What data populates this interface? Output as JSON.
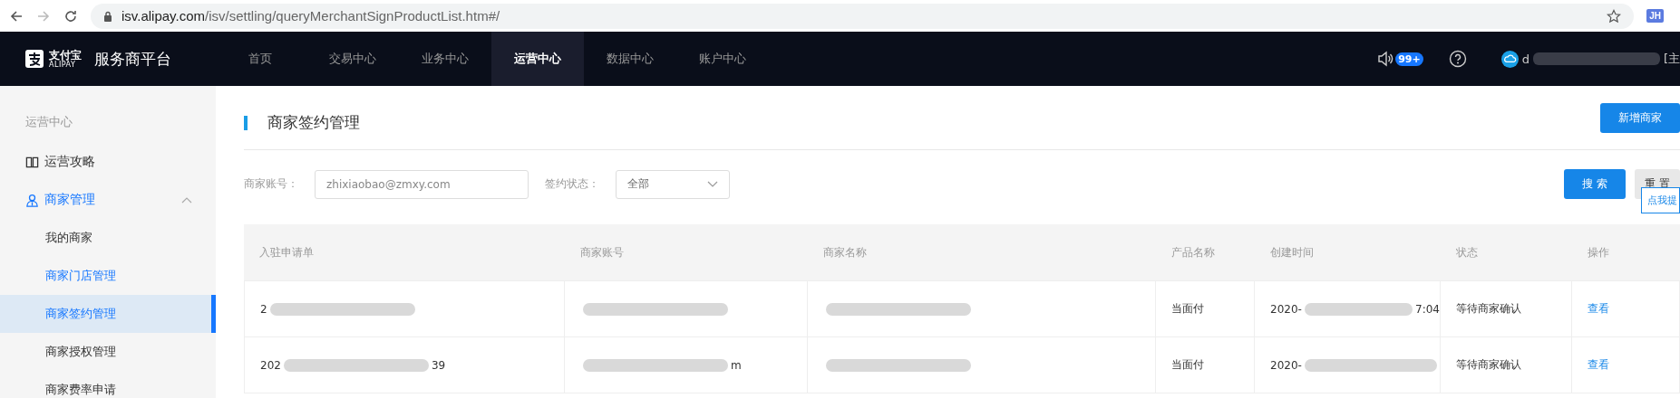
{
  "browser": {
    "url_host": "isv.alipay.com",
    "url_path": "/isv/settling/queryMerchantSignProductList.htm#/",
    "forward_disabled": true,
    "extension": "JH"
  },
  "topnav": {
    "logo_cn": "支付宝",
    "logo_en": "ALIPAY",
    "brand": "服务商平台",
    "items": [
      {
        "label": "首页",
        "selected": false
      },
      {
        "label": "交易中心",
        "selected": false
      },
      {
        "label": "业务中心",
        "selected": false
      },
      {
        "label": "运营中心",
        "selected": true
      },
      {
        "label": "数据中心",
        "selected": false
      },
      {
        "label": "账户中心",
        "selected": false
      }
    ],
    "badge": "99+",
    "user": "d",
    "user_suffix": "[主"
  },
  "sidebar": {
    "heading": "运营中心",
    "items": [
      {
        "label": "运营攻略",
        "expanded": false
      },
      {
        "label": "商家管理",
        "expanded": true,
        "children": [
          {
            "label": "我的商家",
            "selected": false,
            "highlighted": false
          },
          {
            "label": "商家门店管理",
            "selected": false,
            "highlighted": true
          },
          {
            "label": "商家签约管理",
            "selected": true,
            "highlighted": true
          },
          {
            "label": "商家授权管理",
            "selected": false,
            "highlighted": false
          },
          {
            "label": "商家费率申请",
            "selected": false,
            "highlighted": false
          }
        ]
      }
    ]
  },
  "page": {
    "title": "商家签约管理",
    "add_button": "新增商家",
    "filters": {
      "account_label": "商家账号：",
      "account_placeholder": "zhixiaobao@zmxy.com",
      "status_label": "签约状态：",
      "status_value": "全部"
    },
    "search_button": "搜 索",
    "reset_button": "重 置",
    "tooltip": "点我提"
  },
  "table": {
    "columns": [
      "入驻申请单",
      "商家账号",
      "商家名称",
      "产品名称",
      "创建时间",
      "状态",
      "操作"
    ],
    "rows": [
      {
        "cells": [
          {
            "text": "2",
            "blurred": true
          },
          {
            "blurred": true
          },
          {
            "blurred": true
          },
          {
            "text": "当面付"
          },
          {
            "text": "2020-",
            "blurred": true,
            "tail": "7:04"
          },
          {
            "text": "等待商家确认"
          },
          {
            "text": "查看",
            "kind": "link"
          }
        ]
      },
      {
        "cells": [
          {
            "text": "202",
            "blurred": true,
            "tail": "39"
          },
          {
            "blurred": true,
            "tail": "m"
          },
          {
            "blurred": true
          },
          {
            "text": "当面付"
          },
          {
            "text": "2020-",
            "blurred": true
          },
          {
            "text": "等待商家确认"
          },
          {
            "text": "查看",
            "kind": "link"
          }
        ]
      }
    ]
  }
}
